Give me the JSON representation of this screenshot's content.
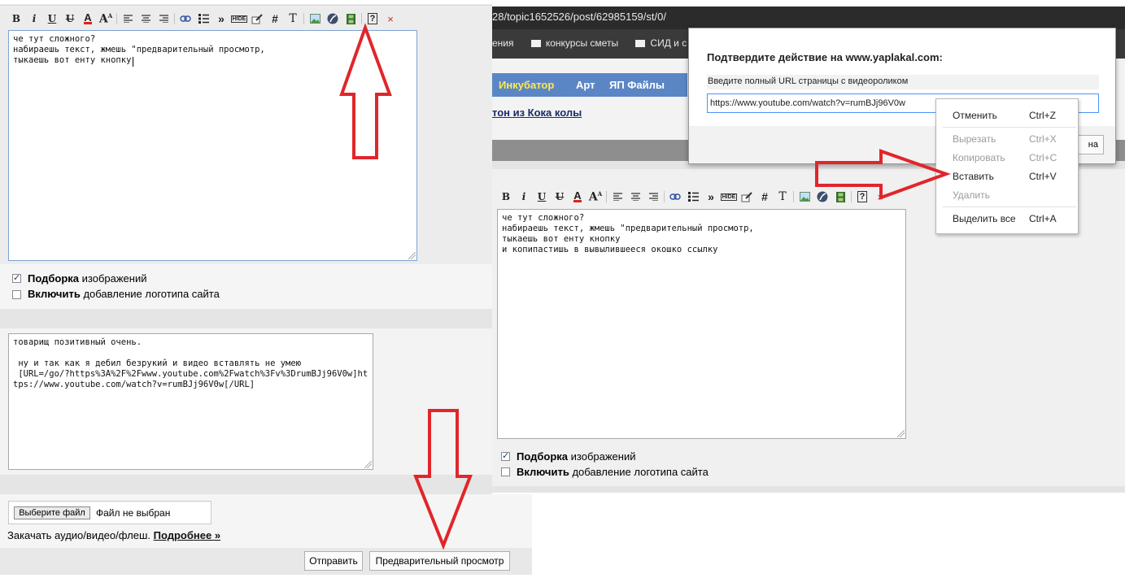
{
  "left_panel": {
    "editor": {
      "text": "че тут сложного?\nнабираешь текст, жмешь \"предварительный просмотр,\nтыкаешь вот енту кнопку "
    },
    "options": {
      "gallery_bold": "Подборка",
      "gallery_rest": "изображений",
      "gallery_checked": true,
      "logo_bold": "Включить",
      "logo_rest": "добавление логотипа сайта",
      "logo_checked": false
    },
    "reply": {
      "text": "товарищ позитивный очень.\n\n ну и так как я дебил безрукий и видео вставлять не умею\n [URL=/go/?https%3A%2F%2Fwww.youtube.com%2Fwatch%3Fv%3DrumBJj96V0w]https://www.youtube.com/watch?v=rumBJj96V0w[/URL]"
    },
    "file": {
      "choose_button": "Выберите файл",
      "status": "Файл не выбран"
    },
    "upload_note": "Закачать аудио/видео/флеш.",
    "upload_more_link": "Подробнее »",
    "send_button": "Отправить",
    "preview_button": "Предварительный просмотр"
  },
  "right_panel": {
    "address_bar": "28/topic1652526/post/62985159/st/0/",
    "bookmarks": [
      "ения",
      "конкурсы сметы",
      "СИД и с"
    ],
    "nav_tabs": [
      "Инкубатор",
      "Арт",
      "ЯП Файлы"
    ],
    "topic_link": "тон из Кока колы",
    "dialog": {
      "title": "Подтвердите действие на www.yaplakal.com:",
      "prompt": "Введите полный URL страницы с видеороликом",
      "input_value": "https://www.youtube.com/watch?v=rumBJj96V0w",
      "partial_button": "на"
    },
    "context_menu": [
      {
        "label": "Отменить",
        "shortcut": "Ctrl+Z",
        "enabled": true
      },
      {
        "label": "Вырезать",
        "shortcut": "Ctrl+X",
        "enabled": false
      },
      {
        "label": "Копировать",
        "shortcut": "Ctrl+C",
        "enabled": false
      },
      {
        "label": "Вставить",
        "shortcut": "Ctrl+V",
        "enabled": true
      },
      {
        "label": "Удалить",
        "shortcut": "",
        "enabled": false
      },
      {
        "label": "Выделить все",
        "shortcut": "Ctrl+A",
        "enabled": true
      }
    ],
    "editor": {
      "text": "че тут сложного?\nнабираешь текст, жмешь \"предварительный просмотр,\nтыкаешь вот енту кнопку\nи копипастишь в вывылившееся окошко ссылку"
    },
    "options": {
      "gallery_bold": "Подборка",
      "gallery_rest": "изображений",
      "gallery_checked": true,
      "logo_bold": "Включить",
      "logo_rest": "добавление логотипа сайта",
      "logo_checked": false
    }
  },
  "toolbar_icons": [
    "bold-icon",
    "italic-icon",
    "underline-icon",
    "strikethrough-icon",
    "font-color-icon",
    "font-size-icon",
    "align-left-icon",
    "align-center-icon",
    "align-right-icon",
    "link-icon",
    "list-icon",
    "quote-icon",
    "hide-icon",
    "edit-icon",
    "hash-icon",
    "text-icon",
    "image-icon",
    "flash-icon",
    "video-icon",
    "help-icon",
    "close-icon"
  ],
  "colors": {
    "arrow_red": "#e0262b",
    "nav_blue": "#5b86c6",
    "nav_highlight": "#ffe94f",
    "link_navy": "#1a2a6a",
    "panel_gray": "#eeeeee"
  }
}
